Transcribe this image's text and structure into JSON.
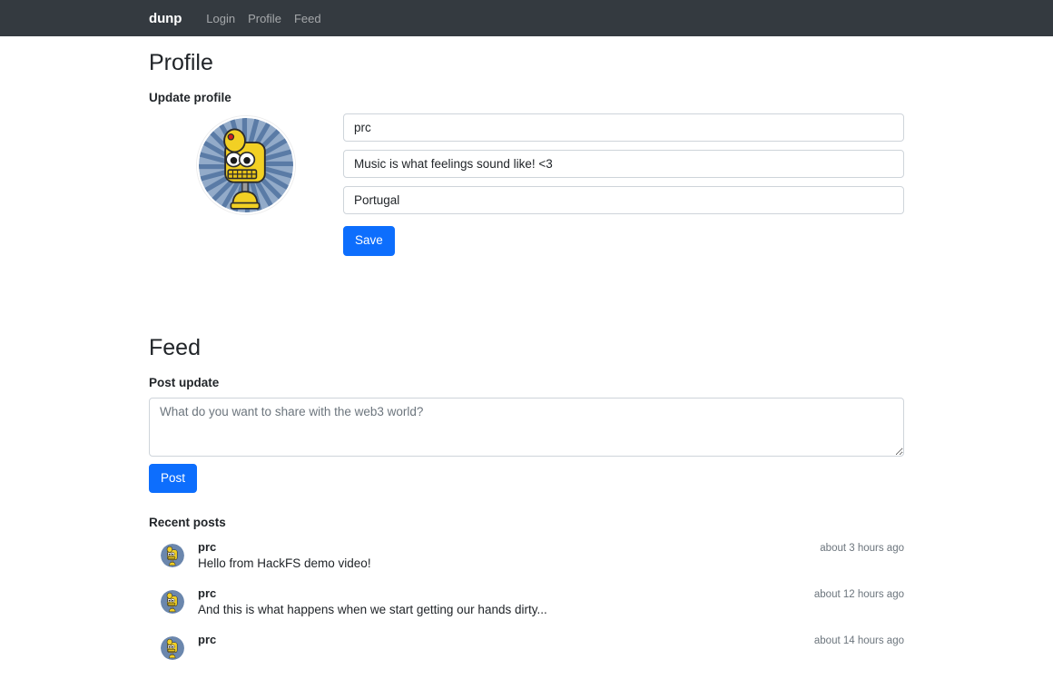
{
  "navbar": {
    "brand": "dunp",
    "links": [
      {
        "label": "Login",
        "name": "nav-link-login"
      },
      {
        "label": "Profile",
        "name": "nav-link-profile"
      },
      {
        "label": "Feed",
        "name": "nav-link-feed"
      }
    ]
  },
  "profile": {
    "title": "Profile",
    "section_label": "Update profile",
    "avatar_icon": "robot-avatar-image",
    "fields": {
      "username": "prc",
      "bio": "Music is what feelings sound like! <3",
      "location": "Portugal"
    },
    "save_label": "Save"
  },
  "feed": {
    "title": "Feed",
    "post_label": "Post update",
    "composer_placeholder": "What do you want to share with the web3 world?",
    "composer_value": "",
    "post_button_label": "Post",
    "recent_label": "Recent posts",
    "posts": [
      {
        "author": "prc",
        "text": "Hello from HackFS demo video!",
        "time": "about 3 hours ago"
      },
      {
        "author": "prc",
        "text": "And this is what happens when we start getting our hands dirty...",
        "time": "about 12 hours ago"
      },
      {
        "author": "prc",
        "text": "",
        "time": "about 14 hours ago"
      }
    ]
  },
  "colors": {
    "navbar_bg": "#343a40",
    "primary": "#0d6efd",
    "muted_text": "#6c757d",
    "border": "#ced4da",
    "avatar_blue_dark": "#5a7ba6",
    "avatar_blue_light": "#93abc9",
    "avatar_yellow": "#f2d024"
  }
}
